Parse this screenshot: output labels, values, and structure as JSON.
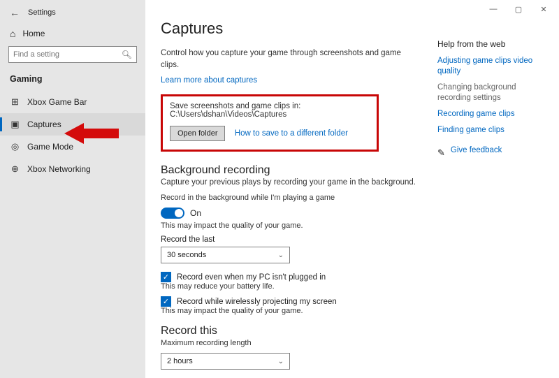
{
  "window": {
    "title": "Settings",
    "home": "Home",
    "search_placeholder": "Find a setting"
  },
  "sidebar": {
    "section": "Gaming",
    "items": [
      {
        "icon": "xbox-icon",
        "label": "Xbox Game Bar"
      },
      {
        "icon": "capture-icon",
        "label": "Captures"
      },
      {
        "icon": "gamemode-icon",
        "label": "Game Mode"
      },
      {
        "icon": "network-icon",
        "label": "Xbox Networking"
      }
    ],
    "selected_index": 1
  },
  "page": {
    "heading": "Captures",
    "intro": "Control how you capture your game through screenshots and game clips.",
    "learn_more": "Learn more about captures",
    "save": {
      "path_label": "Save screenshots and game clips in: C:\\Users\\dshan\\Videos\\Captures",
      "open_folder": "Open folder",
      "how_to": "How to save to a different folder"
    },
    "background": {
      "heading": "Background recording",
      "sub": "Capture your previous plays by recording your game in the background.",
      "toggle_label": "Record in the background while I'm playing a game",
      "toggle_state": "On",
      "toggle_hint": "This may impact the quality of your game.",
      "record_last_label": "Record the last",
      "record_last_value": "30 seconds",
      "plugged_label": "Record even when my PC isn't plugged in",
      "plugged_hint": "This may reduce your battery life.",
      "wireless_label": "Record while wirelessly projecting my screen",
      "wireless_hint": "This may impact the quality of your game."
    },
    "record_this": {
      "heading": "Record this",
      "max_label": "Maximum recording length",
      "max_value": "2 hours"
    }
  },
  "help": {
    "title": "Help from the web",
    "links": {
      "l1": "Adjusting game clips video quality",
      "l2": "Changing background recording settings",
      "l3": "Recording game clips",
      "l4": "Finding game clips"
    },
    "feedback": "Give feedback"
  }
}
